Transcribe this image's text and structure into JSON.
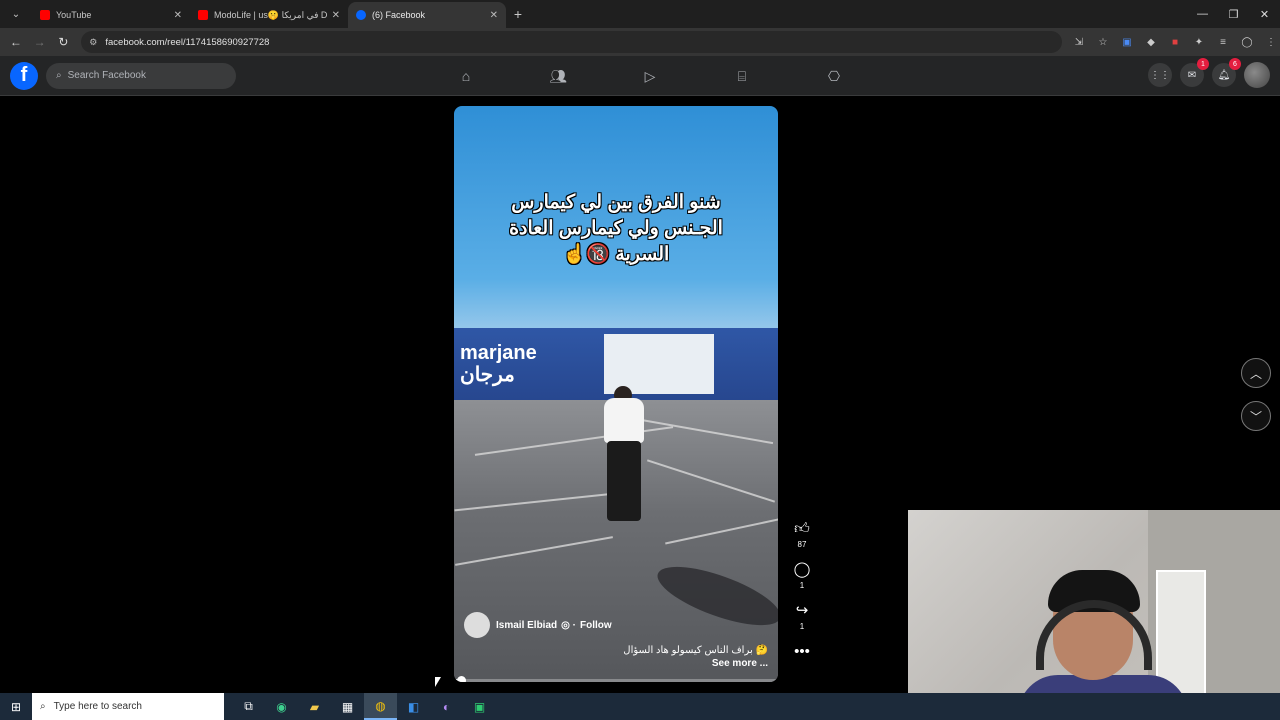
{
  "browser": {
    "tabs": [
      {
        "label": "YouTube",
        "favicon": "youtube-icon",
        "color": "#ff0000"
      },
      {
        "label": "ModoLife | us🤫 في امريكا DEP",
        "favicon": "youtube-icon",
        "color": "#ff0000"
      },
      {
        "label": "(6) Facebook",
        "favicon": "facebook-icon",
        "color": "#0866ff"
      }
    ],
    "active_tab": 2,
    "url": "facebook.com/reel/1174158690927728"
  },
  "facebook": {
    "search_placeholder": "Search Facebook",
    "messenger_badge": "1",
    "notifications_badge": "6",
    "brand_color": "#0866ff"
  },
  "reel": {
    "overlay_text": "شنو الفرق بين لي كيمارس الجـنس ولي كيمارس العادة السرية 🔞☝️",
    "store_sign": "marjane\nمرجان",
    "author": "Ismail Elbiad",
    "follow_label": "Follow",
    "caption": "🤔 براف الناس كيسولو هاد السؤال",
    "see_more": "See more ...",
    "progress": 0.01
  },
  "actions": {
    "likes": "87",
    "comments": "1",
    "shares": "1"
  },
  "taskbar": {
    "search_placeholder": "Type here to search"
  }
}
